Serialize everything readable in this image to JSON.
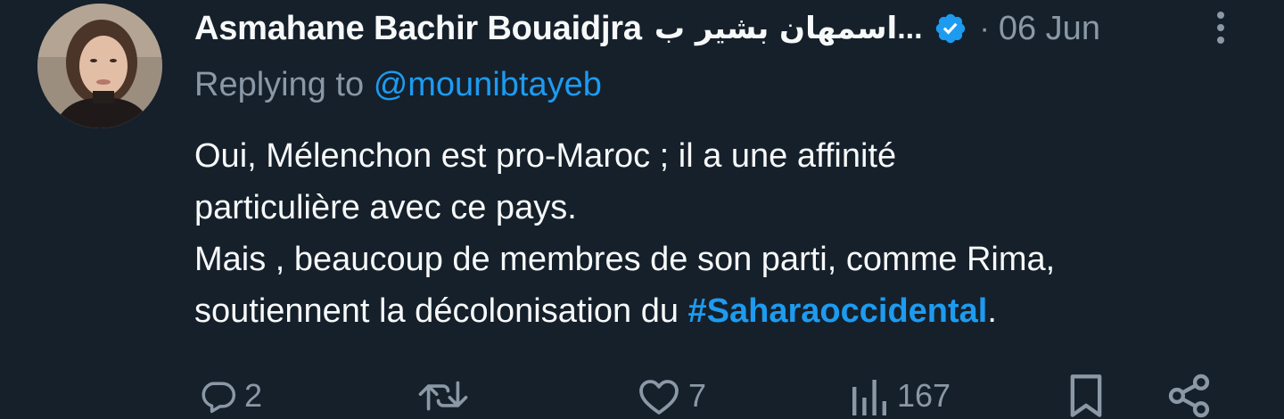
{
  "author": {
    "display_name": "Asmahane Bachir Bouaidjra",
    "display_name_arabic": "اسمهان بشير ب",
    "ellipsis": "...",
    "separator": "·",
    "date": "06 Jun",
    "avatar": "profile-photo",
    "verified_icon": "verified-badge-icon"
  },
  "reply": {
    "prefix": "Replying to",
    "handle": "@mounibtayeb"
  },
  "tweet": {
    "line1": "Oui, Mélenchon est pro-Maroc ; il a une affinité",
    "line2": "particulière avec ce pays.",
    "line3": "Mais , beaucoup de membres de son parti, comme Rima,",
    "line4_prefix": "soutiennent la décolonisation du ",
    "hashtag": "#Saharaoccidental",
    "line4_suffix": "."
  },
  "actions": {
    "reply": {
      "icon": "reply-icon",
      "count": "2"
    },
    "retweet": {
      "icon": "retweet-icon",
      "count": ""
    },
    "like": {
      "icon": "heart-icon",
      "count": "7"
    },
    "views": {
      "icon": "views-icon",
      "count": "167"
    },
    "bookmark": {
      "icon": "bookmark-icon"
    },
    "share": {
      "icon": "share-icon"
    }
  },
  "colors": {
    "background": "#15202b",
    "text_primary": "#f7f9f9",
    "text_secondary": "#8b98a5",
    "accent": "#1d9bf0"
  }
}
